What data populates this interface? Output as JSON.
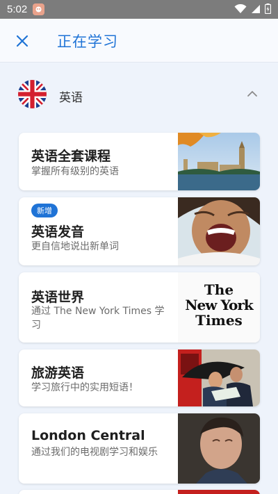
{
  "status": {
    "time": "5:02"
  },
  "header": {
    "title": "正在学习"
  },
  "language": {
    "label": "英语"
  },
  "courses": [
    {
      "title": "英语全套课程",
      "subtitle": "掌握所有级别的英语",
      "thumb": "london-bridge-photo"
    },
    {
      "badge": "新增",
      "title": "英语发音",
      "subtitle": "更自信地说出新单词",
      "thumb": "smiling-woman-photo"
    },
    {
      "title": "英语世界",
      "subtitle": "通过 The New York Times 学习",
      "thumb": "nyt-logo",
      "thumb_text_1": "The",
      "thumb_text_2": "New York",
      "thumb_text_3": "Times"
    },
    {
      "title": "旅游英语",
      "subtitle": "学习旅行中的实用短语！",
      "thumb": "couple-with-map-photo"
    },
    {
      "title": "London Central",
      "subtitle": "通过我们的电视剧学习和娱乐",
      "thumb": "man-looking-up-photo"
    }
  ],
  "colors": {
    "accent": "#1f73d6",
    "background": "#eef3fb"
  }
}
